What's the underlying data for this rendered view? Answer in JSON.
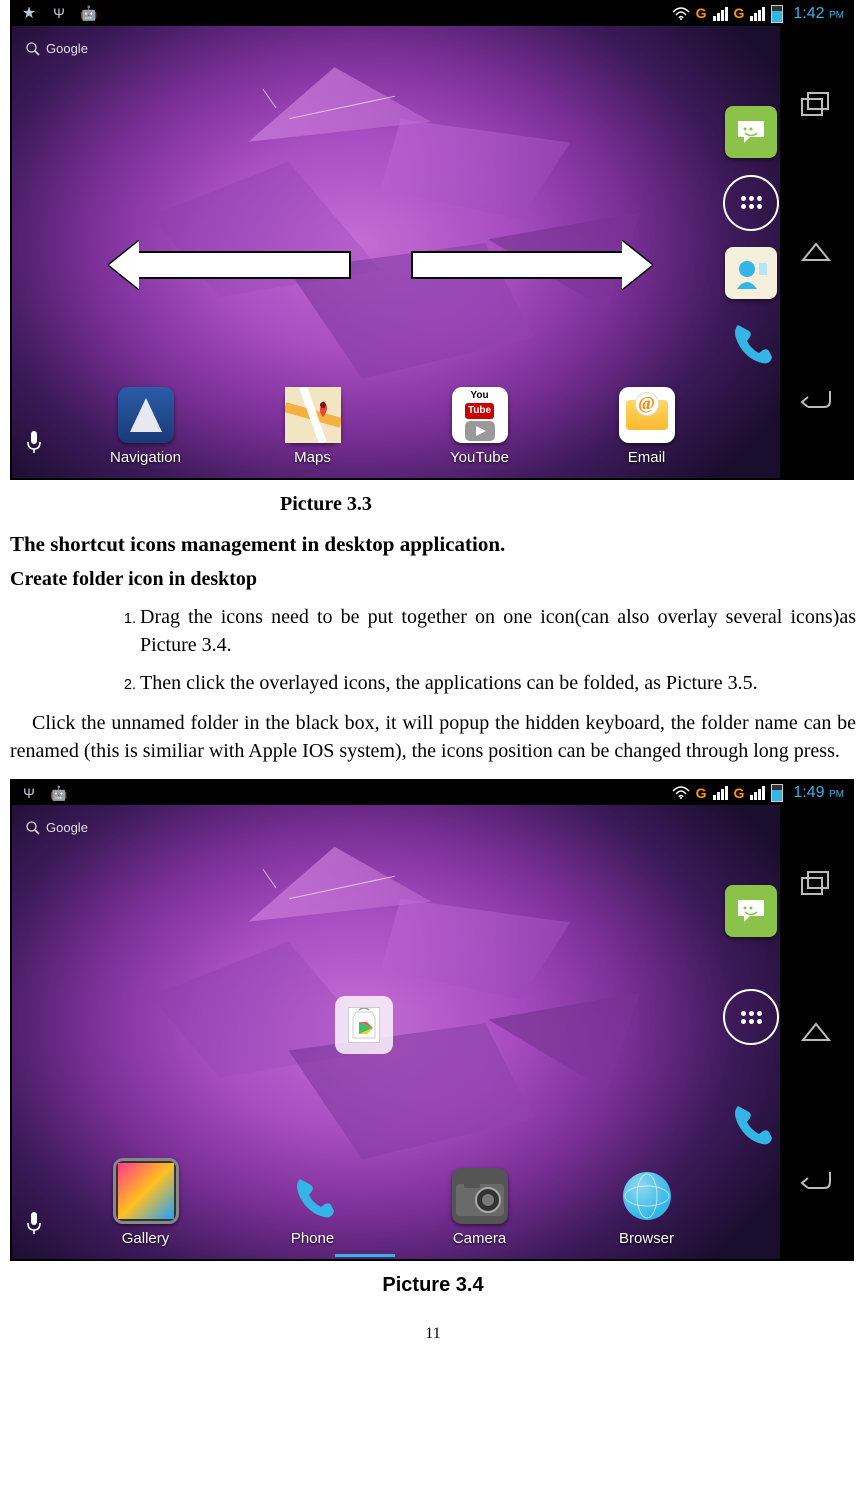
{
  "figure1": {
    "statusbar": {
      "time": "1:42",
      "ampm": "PM",
      "g_indicator": "G"
    },
    "search_label": "Google",
    "dock": [
      {
        "label": "Navigation"
      },
      {
        "label": "Maps"
      },
      {
        "label": "YouTube"
      },
      {
        "label": "Email"
      }
    ],
    "youtube_text_top": "You",
    "youtube_text_tube": "Tube",
    "caption": "Picture 3.3"
  },
  "section_title": "The shortcut icons management in desktop application.",
  "subsection_title": "Create folder icon in desktop",
  "steps": [
    "Drag the icons need to be put together on one icon(can also overlay several icons)as Picture 3.4.",
    "Then click the overlayed icons, the applications can be folded, as Picture 3.5."
  ],
  "paragraph": "Click the unnamed folder in the black box, it will popup the hidden keyboard, the folder name can be renamed (this is similiar with Apple IOS system), the icons position can be changed through long press.",
  "figure2": {
    "statusbar": {
      "time": "1:49",
      "ampm": "PM",
      "g_indicator": "G"
    },
    "search_label": "Google",
    "dock": [
      {
        "label": "Gallery"
      },
      {
        "label": "Phone"
      },
      {
        "label": "Camera"
      },
      {
        "label": "Browser"
      }
    ],
    "caption": "Picture 3.4"
  },
  "page_number": "11"
}
